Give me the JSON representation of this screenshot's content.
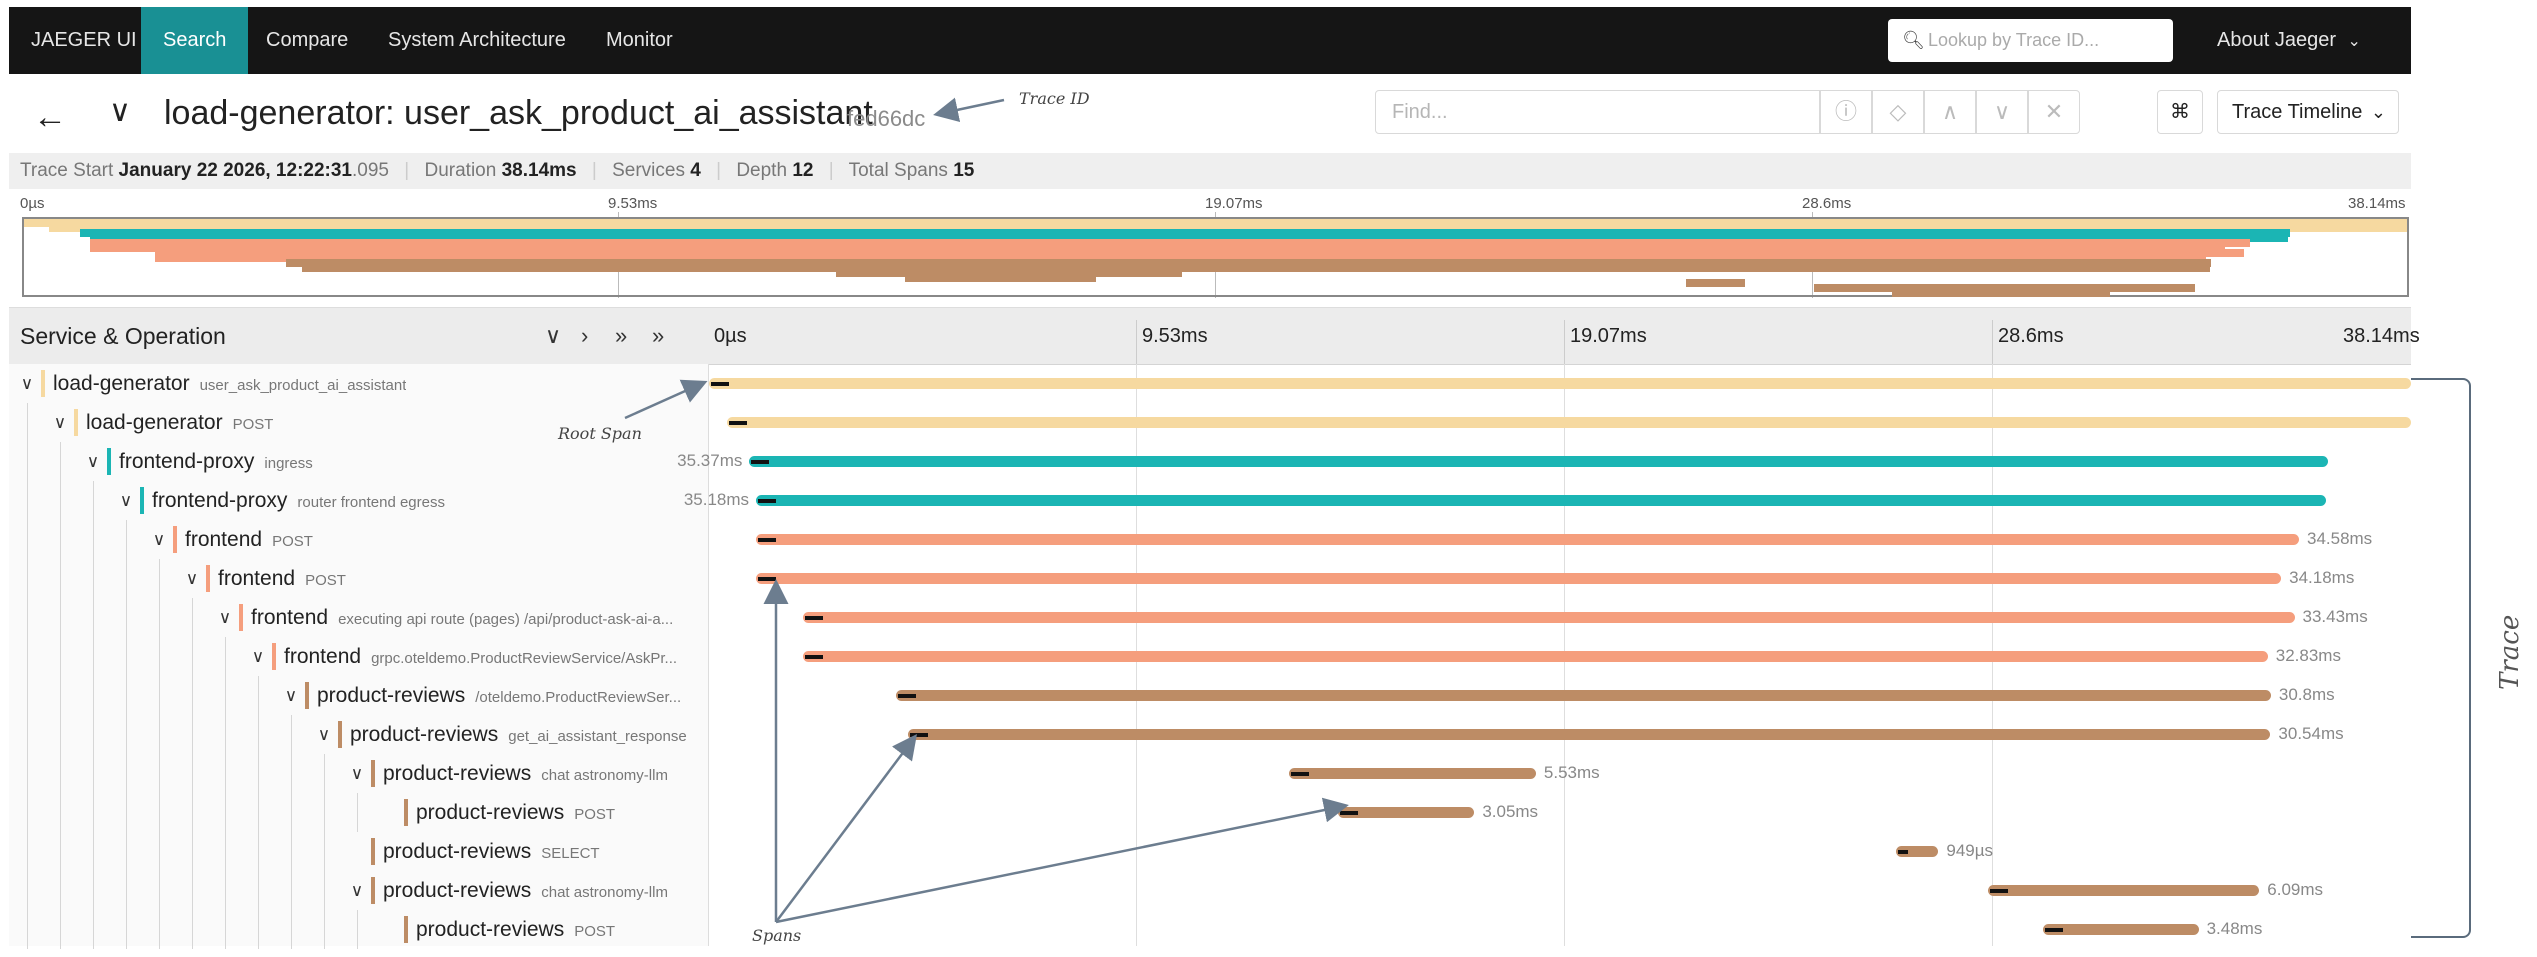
{
  "nav": {
    "brand": "JAEGER UI",
    "items": [
      "Search",
      "Compare",
      "System Architecture",
      "Monitor"
    ],
    "active": "Search",
    "lookup_placeholder": "Lookup by Trace ID...",
    "about": "About Jaeger"
  },
  "trace": {
    "title": "load-generator: user_ask_product_ai_assistant",
    "trace_id": "fed66dc",
    "find_placeholder": "Find...",
    "view_mode": "Trace Timeline",
    "cmd_symbol": "⌘"
  },
  "summary": {
    "start_label": "Trace Start",
    "start_value": "January 22 2026, 12:22:31",
    "start_ms": ".095",
    "duration_label": "Duration",
    "duration_value": "38.14ms",
    "services_label": "Services",
    "services_value": "4",
    "depth_label": "Depth",
    "depth_value": "12",
    "spans_label": "Total Spans",
    "spans_value": "15"
  },
  "timeline": {
    "ticks": [
      "0µs",
      "9.53ms",
      "19.07ms",
      "28.6ms",
      "38.14ms"
    ],
    "column_title": "Service & Operation",
    "total_ms": 38.14
  },
  "colors": {
    "load-generator": "#f6d9a0",
    "frontend-proxy": "#1bb5b4",
    "frontend": "#f59e7d",
    "product-reviews": "#bd8c65",
    "nav_active": "#199094"
  },
  "spans": [
    {
      "service": "load-generator",
      "operation": "user_ask_product_ai_assistant",
      "depth": 0,
      "start_ms": 0,
      "dur_ms": 38.14,
      "dur_label": ""
    },
    {
      "service": "load-generator",
      "operation": "POST",
      "depth": 1,
      "start_ms": 0.4,
      "dur_ms": 37.74,
      "dur_label": ""
    },
    {
      "service": "frontend-proxy",
      "operation": "ingress",
      "depth": 2,
      "start_ms": 0.9,
      "dur_ms": 35.37,
      "dur_label": "35.37ms"
    },
    {
      "service": "frontend-proxy",
      "operation": "router frontend egress",
      "depth": 3,
      "start_ms": 1.05,
      "dur_ms": 35.18,
      "dur_label": "35.18ms"
    },
    {
      "service": "frontend",
      "operation": "POST",
      "depth": 4,
      "start_ms": 1.05,
      "dur_ms": 34.58,
      "dur_label": "34.58ms"
    },
    {
      "service": "frontend",
      "operation": "POST",
      "depth": 5,
      "start_ms": 1.05,
      "dur_ms": 34.18,
      "dur_label": "34.18ms"
    },
    {
      "service": "frontend",
      "operation": "executing api route (pages) /api/product-ask-ai-a...",
      "depth": 6,
      "start_ms": 2.1,
      "dur_ms": 33.43,
      "dur_label": "33.43ms"
    },
    {
      "service": "frontend",
      "operation": "grpc.oteldemo.ProductReviewService/AskPr...",
      "depth": 7,
      "start_ms": 2.1,
      "dur_ms": 32.83,
      "dur_label": "32.83ms"
    },
    {
      "service": "product-reviews",
      "operation": "/oteldemo.ProductReviewSer...",
      "depth": 8,
      "start_ms": 4.2,
      "dur_ms": 30.8,
      "dur_label": "30.8ms"
    },
    {
      "service": "product-reviews",
      "operation": "get_ai_assistant_response",
      "depth": 9,
      "start_ms": 4.45,
      "dur_ms": 30.54,
      "dur_label": "30.54ms"
    },
    {
      "service": "product-reviews",
      "operation": "chat astronomy-llm",
      "depth": 10,
      "start_ms": 13.0,
      "dur_ms": 5.53,
      "dur_label": "5.53ms"
    },
    {
      "service": "product-reviews",
      "operation": "POST",
      "depth": 11,
      "start_ms": 14.1,
      "dur_ms": 3.05,
      "dur_label": "3.05ms"
    },
    {
      "service": "product-reviews",
      "operation": "SELECT",
      "depth": 10,
      "start_ms": 26.6,
      "dur_ms": 0.949,
      "dur_label": "949µs"
    },
    {
      "service": "product-reviews",
      "operation": "chat astronomy-llm",
      "depth": 10,
      "start_ms": 28.65,
      "dur_ms": 6.09,
      "dur_label": "6.09ms"
    },
    {
      "service": "product-reviews",
      "operation": "POST",
      "depth": 11,
      "start_ms": 29.9,
      "dur_ms": 3.48,
      "dur_label": "3.48ms"
    }
  ],
  "annotations": {
    "trace_id": "Trace ID",
    "root_span": "Root Span",
    "spans": "Spans",
    "trace": "Trace"
  }
}
